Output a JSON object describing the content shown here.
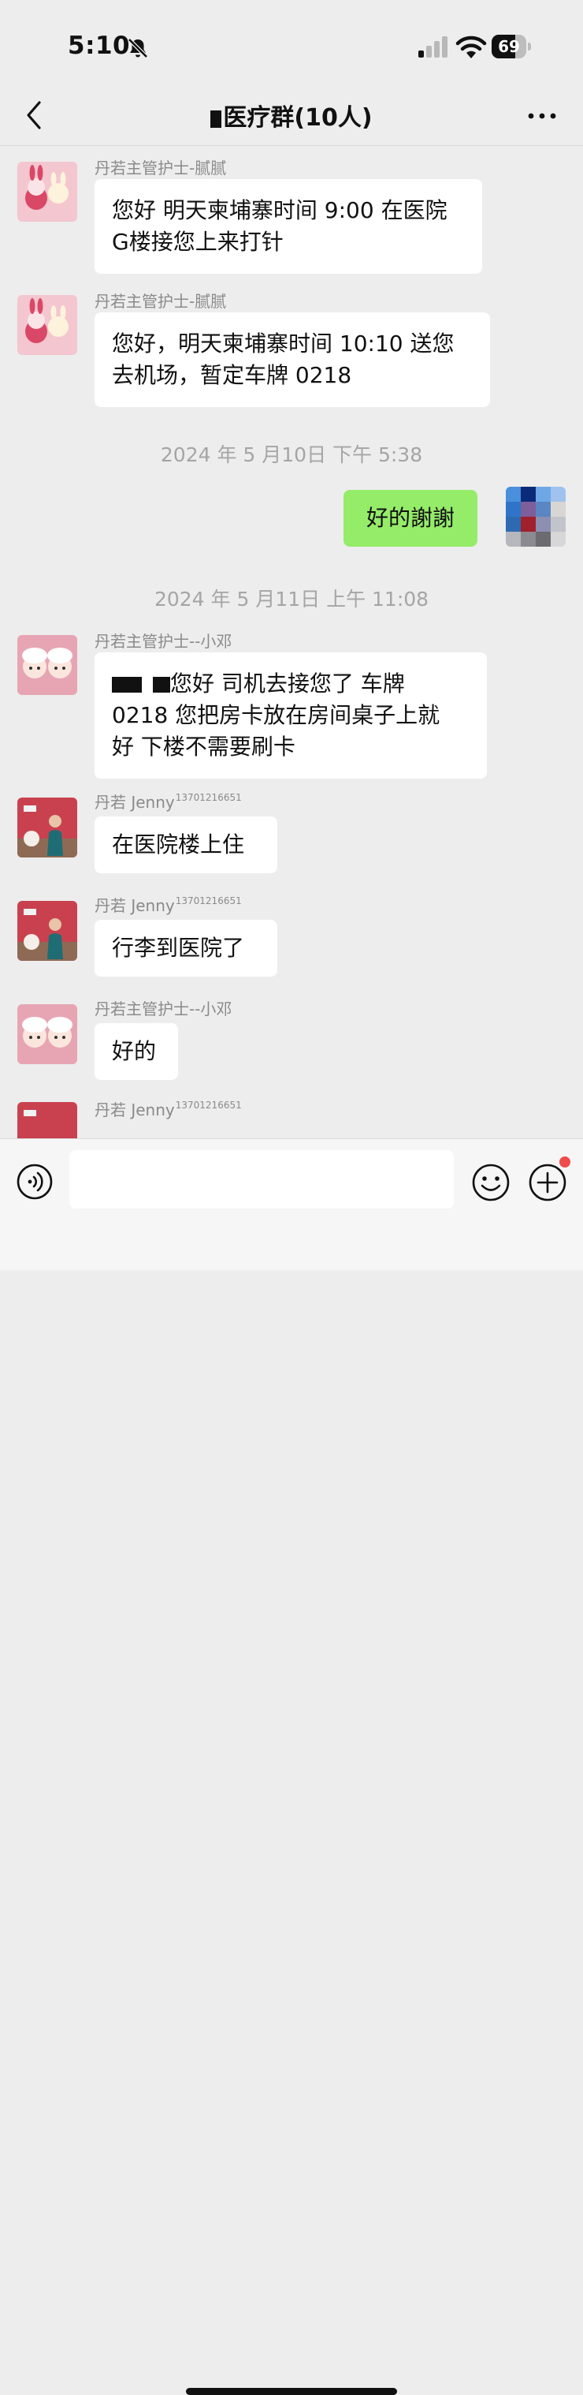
{
  "status_bar": {
    "time": "5:10",
    "battery": "69",
    "battery_level": 0.69
  },
  "nav": {
    "title": "医疗群(10人)"
  },
  "messages": [
    {
      "sender": "丹若主管护士-腻腻",
      "text_line1": "您好 明天柬埔寨时间 9:00 在医院",
      "text_line2": "G楼接您上来打针"
    },
    {
      "sender": "丹若主管护士-腻腻",
      "text_line1": "您好，明天柬埔寨时间 10:10 送您",
      "text_line2": "去机场，暂定车牌 0218"
    }
  ],
  "timestamps": [
    "2024 年 5 月10日 下午 5:38",
    "2024 年 5 月11日 上午 11:08"
  ],
  "my_message": {
    "text": "好的謝謝"
  },
  "msg3": {
    "sender": "丹若主管护士--小邓",
    "line1": "您好 司机去接您了 车牌",
    "line2": "0218 您把房卡放在房间桌子上就",
    "line3": "好 下楼不需要刷卡"
  },
  "msg4": {
    "sender": "丹若 Jenny",
    "sender_sup": "13701216651",
    "text": "在医院楼上住"
  },
  "msg5": {
    "sender": "丹若 Jenny",
    "sender_sup": "13701216651",
    "text": "行李到医院了"
  },
  "msg6": {
    "sender": "丹若主管护士--小邓",
    "text": "好的"
  },
  "msg7": {
    "sender": "丹若 Jenny",
    "sender_sup": "13701216651"
  },
  "input": {
    "placeholder": ""
  },
  "icons": [
    "bell-slash-icon",
    "signal-icon",
    "wifi-icon",
    "battery-icon",
    "back-icon",
    "more-icon",
    "voice-icon",
    "emoji-icon",
    "plus-icon"
  ]
}
